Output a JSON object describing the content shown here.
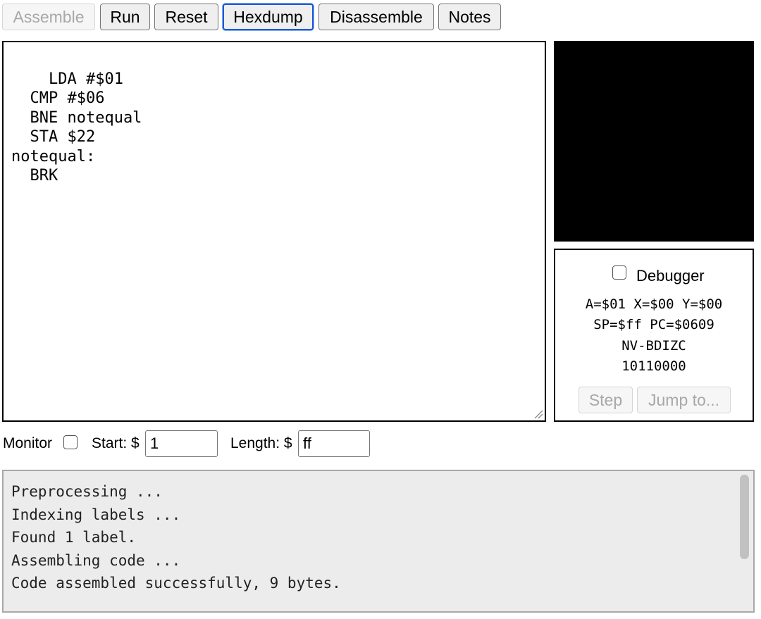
{
  "toolbar": {
    "assemble_label": "Assemble",
    "run_label": "Run",
    "reset_label": "Reset",
    "hexdump_label": "Hexdump",
    "disassemble_label": "Disassemble",
    "notes_label": "Notes"
  },
  "editor": {
    "code": "  LDA #$01\n  CMP #$06\n  BNE notequal\n  STA $22\nnotequal:\n  BRK"
  },
  "debugger": {
    "label": "Debugger",
    "checked": false,
    "registers_line1": "A=$01 X=$00 Y=$00",
    "registers_line2": "SP=$ff PC=$0609",
    "flags_header": "NV-BDIZC",
    "flags_values": "10110000",
    "step_label": "Step",
    "jump_label": "Jump to..."
  },
  "monitor": {
    "label": "Monitor",
    "checked": false,
    "start_label": "Start: $",
    "start_value": "1",
    "length_label": "Length: $",
    "length_value": "ff"
  },
  "messages": {
    "lines": "Preprocessing ...\nIndexing labels ...\nFound 1 label.\nAssembling code ...\nCode assembled successfully, 9 bytes."
  },
  "colors": {
    "screen_background": "#000000",
    "focus_ring": "#1a5ad7",
    "messages_background": "#ececec"
  }
}
